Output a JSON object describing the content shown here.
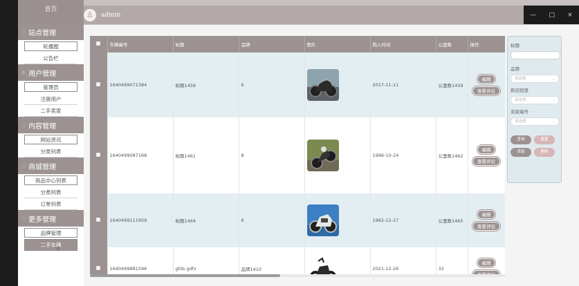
{
  "header": {
    "admin_name": "admin",
    "minimize": "—",
    "maximize": "□",
    "close": "×"
  },
  "sidebar": {
    "home": "首页",
    "groups": [
      {
        "title": "站点管理",
        "items": [
          "轮播图",
          "公告栏"
        ]
      },
      {
        "title": "用户管理",
        "items": [
          "管理员",
          "注册用户",
          "二手卖家"
        ]
      },
      {
        "title": "内容管理",
        "items": [
          "网站资讯",
          "分类列表"
        ]
      },
      {
        "title": "商城管理",
        "items": [
          "商品中心列表",
          "分类列表",
          "订单列表"
        ]
      },
      {
        "title": "更多管理",
        "items": [
          "品牌管理",
          "二手车辆"
        ]
      }
    ]
  },
  "table": {
    "headers": [
      "车辆编号",
      "标题",
      "品牌",
      "图片",
      "购入时间",
      "公里数",
      "操作"
    ],
    "edit_label": "编辑",
    "review_label": "查看评论",
    "rows": [
      {
        "id": "1640499071384",
        "title": "标题1458",
        "brand": "6",
        "date": "2017-11-11",
        "km": "公里数1459"
      },
      {
        "id": "1640499087168",
        "title": "标题1461",
        "brand": "8",
        "date": "1996-10-24",
        "km": "公里数1462"
      },
      {
        "id": "1640499111959",
        "title": "标题1464",
        "brand": "6",
        "date": "1982-12-27",
        "km": "公里数1465"
      },
      {
        "id": "1640499881596",
        "title": "gfds gdfx",
        "brand": "品牌1410",
        "date": "2021-12-26",
        "km": "32"
      }
    ]
  },
  "search": {
    "title_label": "标题",
    "brand_label": "品牌",
    "brand_placeholder": "请选择",
    "condition_label": "新旧程度",
    "condition_placeholder": "请选择",
    "seller_label": "卖家编号",
    "seller_placeholder": "请选择",
    "query_btn": "查询",
    "reset_btn": "重置",
    "add_btn": "添加",
    "delete_btn": "删除"
  }
}
